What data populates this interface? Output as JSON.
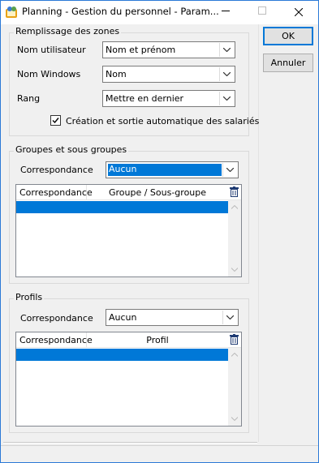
{
  "window": {
    "title": "Planning - Gestion du personnel - Param..."
  },
  "buttons": {
    "ok": "OK",
    "cancel": "Annuler"
  },
  "zones": {
    "title": "Remplissage des zones",
    "fields": [
      {
        "label": "Nom utilisateur",
        "value": "Nom et prénom"
      },
      {
        "label": "Nom Windows",
        "value": "Nom"
      },
      {
        "label": "Rang",
        "value": "Mettre en dernier"
      }
    ],
    "auto_checkbox": {
      "label": "Création et sortie automatique des salariés",
      "checked": true
    }
  },
  "groups": {
    "title": "Groupes et sous groupes",
    "correspondance_label": "Correspondance",
    "correspondance_value": "Aucun",
    "columns": [
      "Correspondance",
      "Groupe / Sous-groupe"
    ]
  },
  "profiles": {
    "title": "Profils",
    "correspondance_label": "Correspondance",
    "correspondance_value": "Aucun",
    "columns": [
      "Correspondance",
      "Profil"
    ]
  },
  "colors": {
    "selection": "#0078d7",
    "accent": "#2b79d7"
  }
}
